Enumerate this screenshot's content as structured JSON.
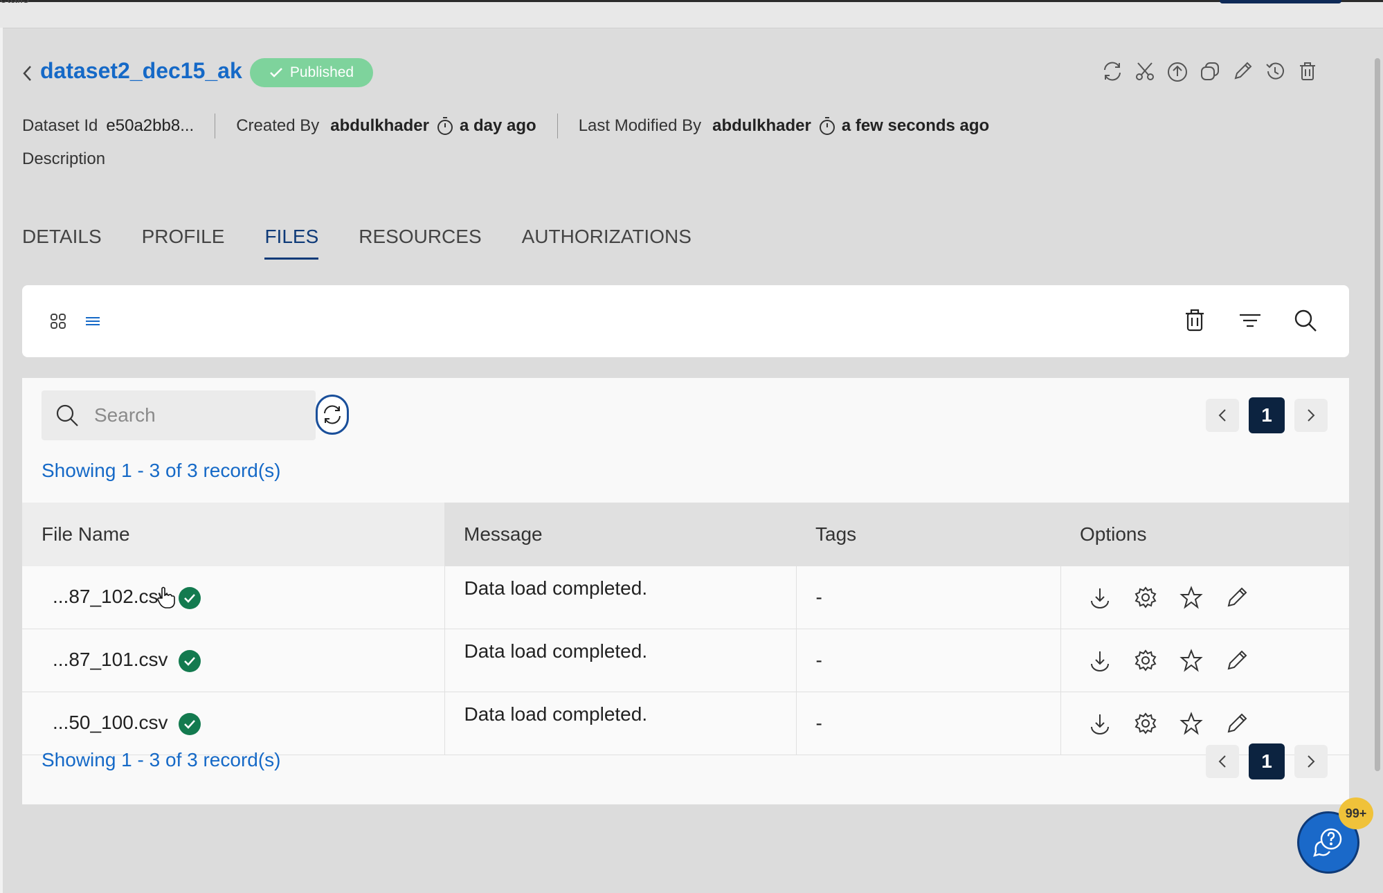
{
  "topbar": {
    "crumb": "etails"
  },
  "header": {
    "title": "dataset2_dec15_ak",
    "status": "Published",
    "actions": [
      "refresh-icon",
      "scissors-icon",
      "upload-icon",
      "copy-icon",
      "edit-icon",
      "history-icon",
      "delete-icon"
    ]
  },
  "meta": {
    "dataset_id_label": "Dataset Id",
    "dataset_id_value": "e50a2bb8...",
    "created_by_label": "Created By",
    "created_by_value": "abdulkhader",
    "created_time": "a day ago",
    "modified_by_label": "Last Modified By",
    "modified_by_value": "abdulkhader",
    "modified_time": "a few seconds ago",
    "description_label": "Description"
  },
  "tabs": [
    {
      "label": "DETAILS"
    },
    {
      "label": "PROFILE"
    },
    {
      "label": "FILES",
      "active": true
    },
    {
      "label": "RESOURCES"
    },
    {
      "label": "AUTHORIZATIONS"
    }
  ],
  "search": {
    "placeholder": "Search",
    "value": ""
  },
  "pagination": {
    "current_page": "1",
    "showing": "Showing 1 - 3 of 3 record(s)"
  },
  "table": {
    "columns": [
      "File Name",
      "Message",
      "Tags",
      "Options"
    ],
    "rows": [
      {
        "file": "...87_102.csv",
        "message": "Data load completed.",
        "tags": "-"
      },
      {
        "file": "...87_101.csv",
        "message": "Data load completed.",
        "tags": "-"
      },
      {
        "file": "...50_100.csv",
        "message": "Data load completed.",
        "tags": "-"
      }
    ],
    "option_icons": [
      "download-icon",
      "settings-icon",
      "star-icon",
      "edit-icon"
    ]
  },
  "help": {
    "badge": "99+"
  },
  "colors": {
    "accent": "#1569c7",
    "navy": "#0c2340",
    "success": "#137a4f",
    "published": "#7ed39c",
    "badge": "#f0c23a"
  }
}
